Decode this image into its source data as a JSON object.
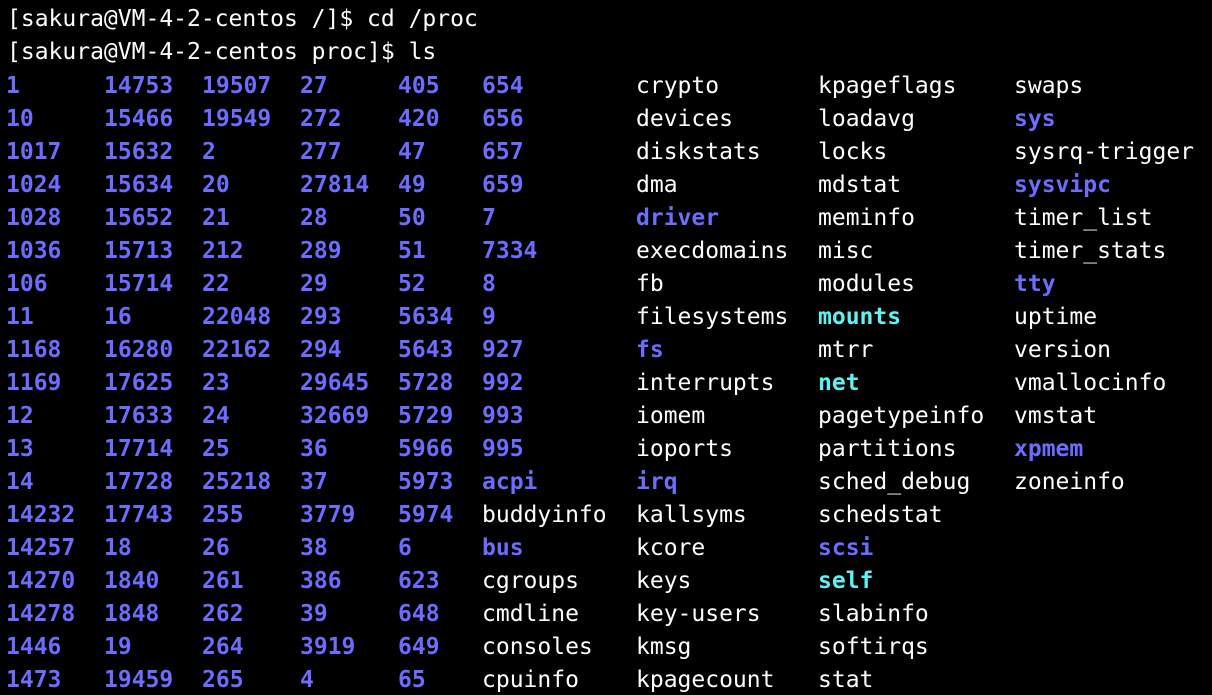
{
  "terminal": {
    "lines": [
      "[sakura@VM-4-2-centos /]$ cd /proc",
      "[sakura@VM-4-2-centos proc]$ ls"
    ],
    "colors": {
      "background": "#000000",
      "file": "#ffffff",
      "directory": "#6c6cff",
      "symlink": "#5ff2f2"
    },
    "ls_columns": [
      [
        {
          "name": "1",
          "type": "dir"
        },
        {
          "name": "10",
          "type": "dir"
        },
        {
          "name": "1017",
          "type": "dir"
        },
        {
          "name": "1024",
          "type": "dir"
        },
        {
          "name": "1028",
          "type": "dir"
        },
        {
          "name": "1036",
          "type": "dir"
        },
        {
          "name": "106",
          "type": "dir"
        },
        {
          "name": "11",
          "type": "dir"
        },
        {
          "name": "1168",
          "type": "dir"
        },
        {
          "name": "1169",
          "type": "dir"
        },
        {
          "name": "12",
          "type": "dir"
        },
        {
          "name": "13",
          "type": "dir"
        },
        {
          "name": "14",
          "type": "dir"
        },
        {
          "name": "14232",
          "type": "dir"
        },
        {
          "name": "14257",
          "type": "dir"
        },
        {
          "name": "14270",
          "type": "dir"
        },
        {
          "name": "14278",
          "type": "dir"
        },
        {
          "name": "1446",
          "type": "dir"
        },
        {
          "name": "1473",
          "type": "dir"
        }
      ],
      [
        {
          "name": "14753",
          "type": "dir"
        },
        {
          "name": "15466",
          "type": "dir"
        },
        {
          "name": "15632",
          "type": "dir"
        },
        {
          "name": "15634",
          "type": "dir"
        },
        {
          "name": "15652",
          "type": "dir"
        },
        {
          "name": "15713",
          "type": "dir"
        },
        {
          "name": "15714",
          "type": "dir"
        },
        {
          "name": "16",
          "type": "dir"
        },
        {
          "name": "16280",
          "type": "dir"
        },
        {
          "name": "17625",
          "type": "dir"
        },
        {
          "name": "17633",
          "type": "dir"
        },
        {
          "name": "17714",
          "type": "dir"
        },
        {
          "name": "17728",
          "type": "dir"
        },
        {
          "name": "17743",
          "type": "dir"
        },
        {
          "name": "18",
          "type": "dir"
        },
        {
          "name": "1840",
          "type": "dir"
        },
        {
          "name": "1848",
          "type": "dir"
        },
        {
          "name": "19",
          "type": "dir"
        },
        {
          "name": "19459",
          "type": "dir"
        }
      ],
      [
        {
          "name": "19507",
          "type": "dir"
        },
        {
          "name": "19549",
          "type": "dir"
        },
        {
          "name": "2",
          "type": "dir"
        },
        {
          "name": "20",
          "type": "dir"
        },
        {
          "name": "21",
          "type": "dir"
        },
        {
          "name": "212",
          "type": "dir"
        },
        {
          "name": "22",
          "type": "dir"
        },
        {
          "name": "22048",
          "type": "dir"
        },
        {
          "name": "22162",
          "type": "dir"
        },
        {
          "name": "23",
          "type": "dir"
        },
        {
          "name": "24",
          "type": "dir"
        },
        {
          "name": "25",
          "type": "dir"
        },
        {
          "name": "25218",
          "type": "dir"
        },
        {
          "name": "255",
          "type": "dir"
        },
        {
          "name": "26",
          "type": "dir"
        },
        {
          "name": "261",
          "type": "dir"
        },
        {
          "name": "262",
          "type": "dir"
        },
        {
          "name": "264",
          "type": "dir"
        },
        {
          "name": "265",
          "type": "dir"
        }
      ],
      [
        {
          "name": "27",
          "type": "dir"
        },
        {
          "name": "272",
          "type": "dir"
        },
        {
          "name": "277",
          "type": "dir"
        },
        {
          "name": "27814",
          "type": "dir"
        },
        {
          "name": "28",
          "type": "dir"
        },
        {
          "name": "289",
          "type": "dir"
        },
        {
          "name": "29",
          "type": "dir"
        },
        {
          "name": "293",
          "type": "dir"
        },
        {
          "name": "294",
          "type": "dir"
        },
        {
          "name": "29645",
          "type": "dir"
        },
        {
          "name": "32669",
          "type": "dir"
        },
        {
          "name": "36",
          "type": "dir"
        },
        {
          "name": "37",
          "type": "dir"
        },
        {
          "name": "3779",
          "type": "dir"
        },
        {
          "name": "38",
          "type": "dir"
        },
        {
          "name": "386",
          "type": "dir"
        },
        {
          "name": "39",
          "type": "dir"
        },
        {
          "name": "3919",
          "type": "dir"
        },
        {
          "name": "4",
          "type": "dir"
        }
      ],
      [
        {
          "name": "405",
          "type": "dir"
        },
        {
          "name": "420",
          "type": "dir"
        },
        {
          "name": "47",
          "type": "dir"
        },
        {
          "name": "49",
          "type": "dir"
        },
        {
          "name": "50",
          "type": "dir"
        },
        {
          "name": "51",
          "type": "dir"
        },
        {
          "name": "52",
          "type": "dir"
        },
        {
          "name": "5634",
          "type": "dir"
        },
        {
          "name": "5643",
          "type": "dir"
        },
        {
          "name": "5728",
          "type": "dir"
        },
        {
          "name": "5729",
          "type": "dir"
        },
        {
          "name": "5966",
          "type": "dir"
        },
        {
          "name": "5973",
          "type": "dir"
        },
        {
          "name": "5974",
          "type": "dir"
        },
        {
          "name": "6",
          "type": "dir"
        },
        {
          "name": "623",
          "type": "dir"
        },
        {
          "name": "648",
          "type": "dir"
        },
        {
          "name": "649",
          "type": "dir"
        },
        {
          "name": "65",
          "type": "dir"
        }
      ],
      [
        {
          "name": "654",
          "type": "dir"
        },
        {
          "name": "656",
          "type": "dir"
        },
        {
          "name": "657",
          "type": "dir"
        },
        {
          "name": "659",
          "type": "dir"
        },
        {
          "name": "7",
          "type": "dir"
        },
        {
          "name": "7334",
          "type": "dir"
        },
        {
          "name": "8",
          "type": "dir"
        },
        {
          "name": "9",
          "type": "dir"
        },
        {
          "name": "927",
          "type": "dir"
        },
        {
          "name": "992",
          "type": "dir"
        },
        {
          "name": "993",
          "type": "dir"
        },
        {
          "name": "995",
          "type": "dir"
        },
        {
          "name": "acpi",
          "type": "dir"
        },
        {
          "name": "buddyinfo",
          "type": "file"
        },
        {
          "name": "bus",
          "type": "dir"
        },
        {
          "name": "cgroups",
          "type": "file"
        },
        {
          "name": "cmdline",
          "type": "file"
        },
        {
          "name": "consoles",
          "type": "file"
        },
        {
          "name": "cpuinfo",
          "type": "file"
        }
      ],
      [
        {
          "name": "crypto",
          "type": "file"
        },
        {
          "name": "devices",
          "type": "file"
        },
        {
          "name": "diskstats",
          "type": "file"
        },
        {
          "name": "dma",
          "type": "file"
        },
        {
          "name": "driver",
          "type": "dir"
        },
        {
          "name": "execdomains",
          "type": "file"
        },
        {
          "name": "fb",
          "type": "file"
        },
        {
          "name": "filesystems",
          "type": "file"
        },
        {
          "name": "fs",
          "type": "dir"
        },
        {
          "name": "interrupts",
          "type": "file"
        },
        {
          "name": "iomem",
          "type": "file"
        },
        {
          "name": "ioports",
          "type": "file"
        },
        {
          "name": "irq",
          "type": "dir"
        },
        {
          "name": "kallsyms",
          "type": "file"
        },
        {
          "name": "kcore",
          "type": "file"
        },
        {
          "name": "keys",
          "type": "file"
        },
        {
          "name": "key-users",
          "type": "file"
        },
        {
          "name": "kmsg",
          "type": "file"
        },
        {
          "name": "kpagecount",
          "type": "file"
        }
      ],
      [
        {
          "name": "kpageflags",
          "type": "file"
        },
        {
          "name": "loadavg",
          "type": "file"
        },
        {
          "name": "locks",
          "type": "file"
        },
        {
          "name": "mdstat",
          "type": "file"
        },
        {
          "name": "meminfo",
          "type": "file"
        },
        {
          "name": "misc",
          "type": "file"
        },
        {
          "name": "modules",
          "type": "file"
        },
        {
          "name": "mounts",
          "type": "link"
        },
        {
          "name": "mtrr",
          "type": "file"
        },
        {
          "name": "net",
          "type": "link"
        },
        {
          "name": "pagetypeinfo",
          "type": "file"
        },
        {
          "name": "partitions",
          "type": "file"
        },
        {
          "name": "sched_debug",
          "type": "file"
        },
        {
          "name": "schedstat",
          "type": "file"
        },
        {
          "name": "scsi",
          "type": "dir"
        },
        {
          "name": "self",
          "type": "link"
        },
        {
          "name": "slabinfo",
          "type": "file"
        },
        {
          "name": "softirqs",
          "type": "file"
        },
        {
          "name": "stat",
          "type": "file"
        }
      ],
      [
        {
          "name": "swaps",
          "type": "file"
        },
        {
          "name": "sys",
          "type": "dir"
        },
        {
          "name": "sysrq-trigger",
          "type": "file"
        },
        {
          "name": "sysvipc",
          "type": "dir"
        },
        {
          "name": "timer_list",
          "type": "file"
        },
        {
          "name": "timer_stats",
          "type": "file"
        },
        {
          "name": "tty",
          "type": "dir"
        },
        {
          "name": "uptime",
          "type": "file"
        },
        {
          "name": "version",
          "type": "file"
        },
        {
          "name": "vmallocinfo",
          "type": "file"
        },
        {
          "name": "vmstat",
          "type": "file"
        },
        {
          "name": "xpmem",
          "type": "dir"
        },
        {
          "name": "zoneinfo",
          "type": "file"
        }
      ]
    ]
  }
}
